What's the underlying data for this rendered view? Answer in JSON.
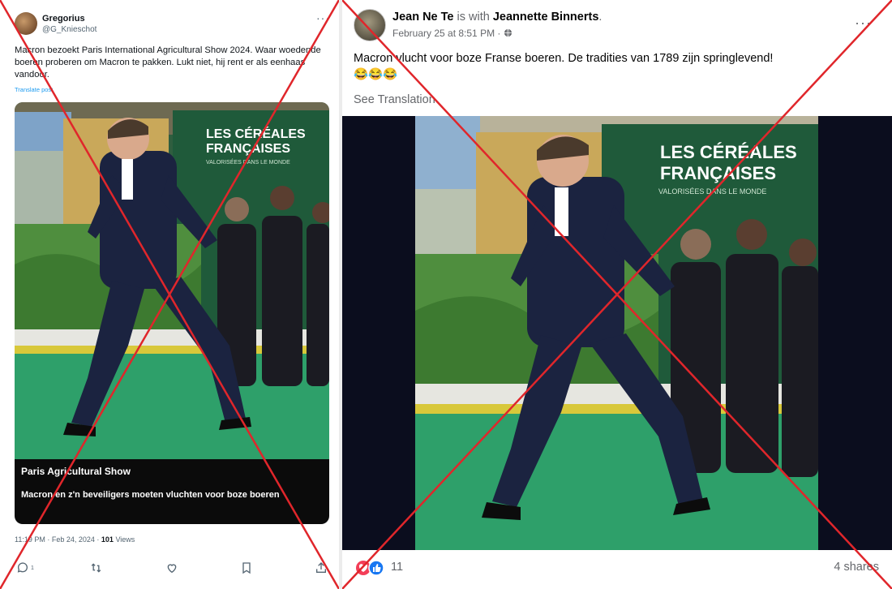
{
  "left_post": {
    "author": "Gregorius",
    "handle": "@G_Knieschot",
    "more": "···",
    "text": "Macron bezoekt Paris International Agricultural Show 2024. Waar woedende boeren proberen om Macron te pakken. Lukt niet, hij rent er als eenhaas vandoor.",
    "translate": "Translate post",
    "image": {
      "sign_line1": "LES CÉRÉALES",
      "sign_line2": "FRANÇAISES",
      "sign_line3": "VALORISÉES DANS LE MONDE",
      "caption_title": "Paris Agricultural Show",
      "caption_subtitle": "Macron en z'n beveiligers moeten vluchten voor boze boeren"
    },
    "time": "11:19 PM · Feb 24, 2024 · ",
    "views_count": "101",
    "views_label": " Views",
    "actions": {
      "reply_count": "1",
      "icons": [
        "reply-icon",
        "repost-icon",
        "like-icon",
        "bookmark-icon",
        "share-icon"
      ]
    }
  },
  "right_post": {
    "author": "Jean Ne Te",
    "with_text": " is with ",
    "tagged": "Jeannette Binnerts",
    "tagged_suffix": ".",
    "date": "February 25 at 8:51 PM · ",
    "more": "···",
    "text": "Macron vlucht voor boze Franse boeren. De tradities van 1789 zijn springlevend!",
    "emoji": "😂😂😂",
    "see_translation": "See Translation",
    "image": {
      "sign_line1": "LES CÉRÉALES",
      "sign_line2": "FRANÇAISES",
      "sign_line3": "VALORISÉES DANS LE MONDE"
    },
    "reactions_count": "11",
    "shares": "4 shares"
  },
  "colors": {
    "cross": "#e0262b",
    "twitter_link": "#1d9bf0",
    "fb_like": "#1877f2",
    "fb_love": "#f33e58",
    "sign_green": "#1f5a3a",
    "carpet": "#2ea06a"
  }
}
